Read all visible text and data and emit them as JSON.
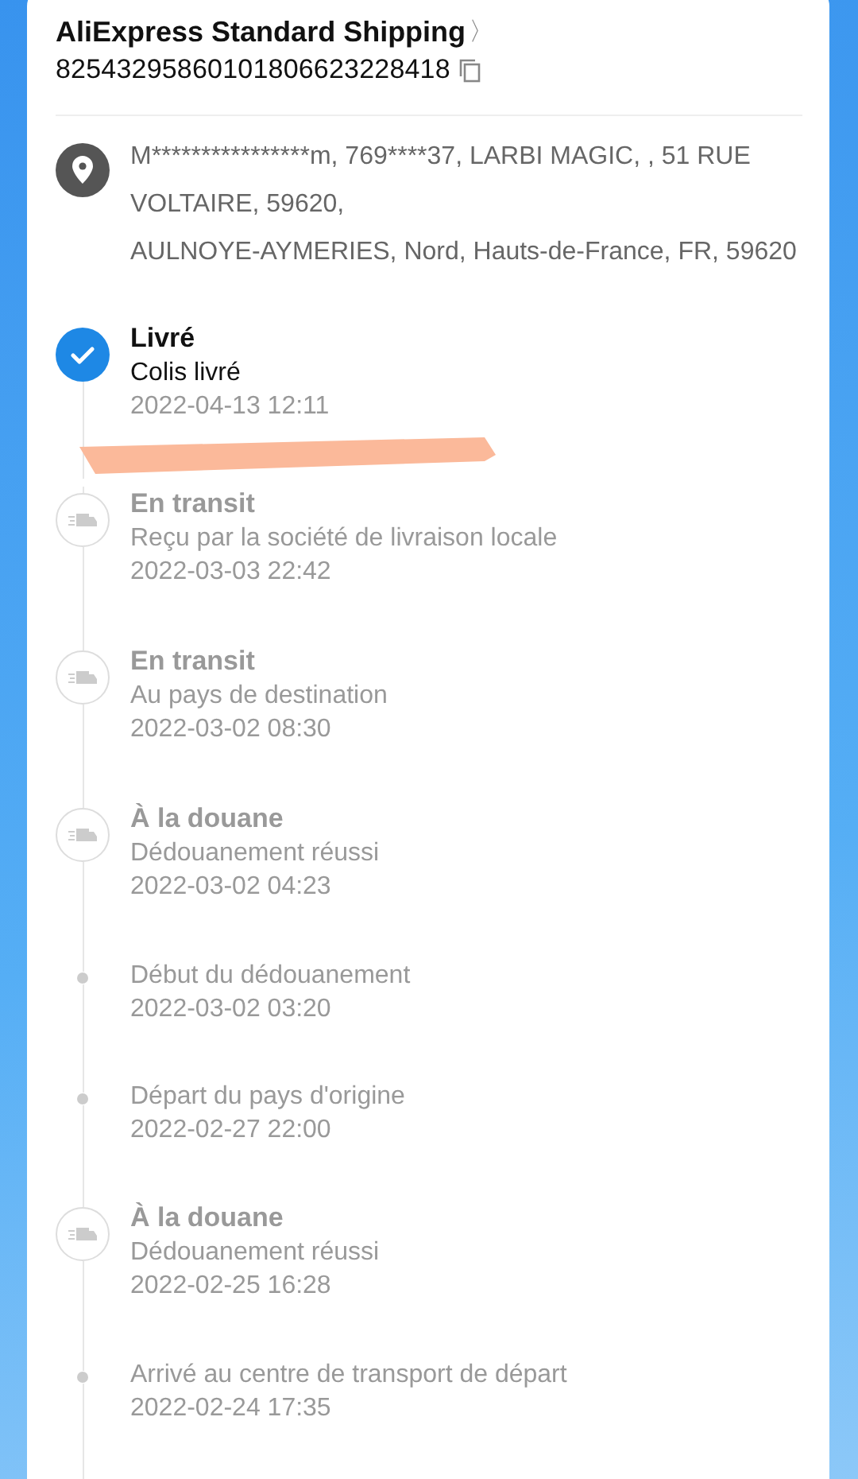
{
  "shipping": {
    "carrier": "AliExpress Standard Shipping",
    "chevron": "〉",
    "tracking_number": "82543295860101806623228418"
  },
  "address": [
    "M****************m,  769****37,  LARBI MAGIC, , 51 RUE VOLTAIRE, 59620,",
    "AULNOYE-AYMERIES,  Nord,  Hauts-de-France,  FR,  59620"
  ],
  "events": [
    {
      "kind": "delivered",
      "title": "Livré",
      "detail": "Colis livré",
      "time": "2022-04-13 12:11"
    },
    {
      "kind": "milestone",
      "title": "En transit",
      "detail": "Reçu par la société de livraison locale",
      "time": "2022-03-03 22:42"
    },
    {
      "kind": "milestone",
      "title": "En transit",
      "detail": "Au pays de destination",
      "time": "2022-03-02 08:30"
    },
    {
      "kind": "milestone",
      "title": "À la douane",
      "detail": "Dédouanement réussi",
      "time": "2022-03-02 04:23"
    },
    {
      "kind": "step",
      "detail": "Début du dédouanement",
      "time": "2022-03-02 03:20"
    },
    {
      "kind": "step",
      "detail": "Départ du pays d'origine",
      "time": "2022-02-27 22:00"
    },
    {
      "kind": "milestone",
      "title": "À la douane",
      "detail": "Dédouanement réussi",
      "time": "2022-02-25 16:28"
    },
    {
      "kind": "step",
      "detail": "Arrivé au centre de transport de départ",
      "time": "2022-02-24 17:35"
    }
  ]
}
